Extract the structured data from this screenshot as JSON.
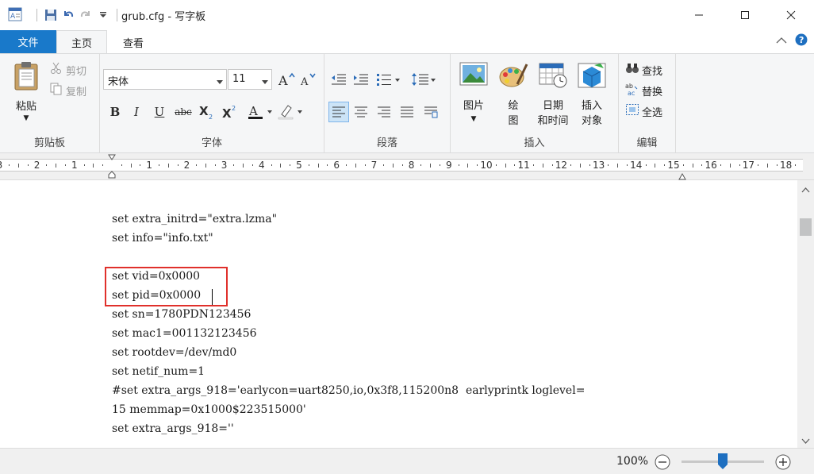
{
  "window": {
    "title": "grub.cfg - 写字板",
    "minimize_glyph": "—",
    "maximize_glyph": "☐",
    "close_glyph": "✕"
  },
  "tabs": {
    "file": "文件",
    "home": "主页",
    "view": "查看"
  },
  "ribbon": {
    "clipboard": {
      "label": "剪贴板",
      "paste": "粘贴",
      "cut": "剪切",
      "copy": "复制"
    },
    "font": {
      "label": "字体",
      "family": "宋体",
      "size": "11"
    },
    "paragraph": {
      "label": "段落"
    },
    "insert": {
      "label": "插入",
      "picture": "图片",
      "paint_l1": "绘",
      "paint_l2": "图",
      "datetime_l1": "日期",
      "datetime_l2": "和时间",
      "object_l1": "插入",
      "object_l2": "对象"
    },
    "editing": {
      "label": "编辑",
      "find": "查找",
      "replace": "替换",
      "select_all": "全选"
    }
  },
  "ruler": {
    "labels": [
      "3",
      "2",
      "1",
      "1",
      "2",
      "3",
      "4",
      "5",
      "6",
      "7",
      "8",
      "9",
      "10",
      "11",
      "12",
      "13",
      "14",
      "15",
      "16",
      "17",
      "18"
    ]
  },
  "document": {
    "lines": [
      "set extra_initrd=\"extra.lzma\"",
      "set info=\"info.txt\"",
      "",
      "set vid=0x0000",
      "set pid=0x0000",
      "set sn=1780PDN123456",
      "set mac1=001132123456",
      "set rootdev=/dev/md0",
      "set netif_num=1",
      "#set extra_args_918='earlycon=uart8250,io,0x3f8,115200n8  earlyprintk loglevel=",
      "15 memmap=0x1000$223515000'",
      "set extra_args_918=''"
    ]
  },
  "statusbar": {
    "zoom": "100%",
    "zoom_level_percent": 100
  },
  "colors": {
    "file_tab": "#1979ca",
    "highlight_box": "#e0302b",
    "ribbon_bg": "#f5f6f7"
  }
}
